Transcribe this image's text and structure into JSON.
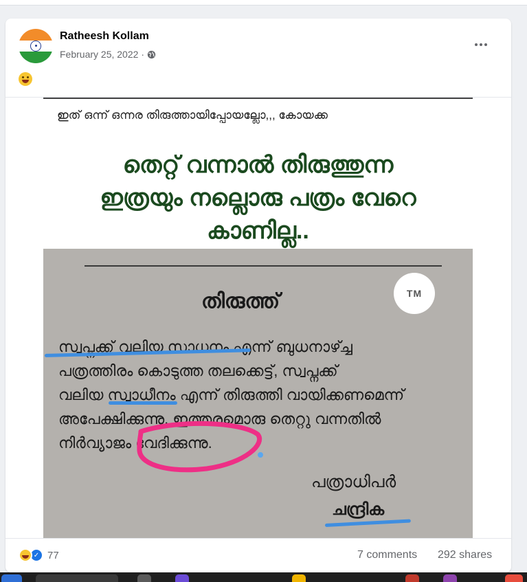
{
  "post": {
    "author": "Ratheesh Kollam",
    "date": "February 25, 2022",
    "separator": "·",
    "privacy_icon": "globe-icon",
    "more_icon": "more-horizontal-icon",
    "post_emoji": "grinning-tongue-emoji"
  },
  "image": {
    "caption_line": "ഇത് ഒന്ന് ഒന്നര തിരുത്തായിപ്പോയല്ലോ,,, കോയക്ക",
    "headline_1": "തെറ്റ് വന്നാൽ തിരുത്തുന്ന",
    "headline_2": "ഇത്രയും നല്ലൊരു പത്രം വേറെ",
    "headline_3": "കാണില്ല..",
    "watermark": "TM",
    "paper_title": "തിരുത്ത്",
    "body_1": "സ്വപ്നക്ക് വലിയ സാധനം എന്ന് ബുധനാഴ്ച്ച",
    "body_2": "പത്രത്തിരം കൊടുത്ത തലക്കെട്ട്, സ്വപ്നക്ക്",
    "body_3": "വലിയ സ്വാധീനം എന്ന് തിരുത്തി വായിക്കണമെന്ന്",
    "body_4": "അപേക്ഷിക്കുന്നു. ഇത്തരമൊരു തെറ്റു വന്നതിൽ",
    "body_5": "നിർവ്യാജം വേദിക്കുന്നു.",
    "signature_1": "പത്രാധിപർ",
    "signature_2": "ചന്ദ്രിക"
  },
  "footer": {
    "reaction_count": "77",
    "comments": "7 comments",
    "shares": "292 shares",
    "reaction_icons": [
      "haha-icon",
      "like-icon"
    ]
  },
  "colors": {
    "headline": "#1b4a1f",
    "annotation_blue": "#3f8ee0",
    "annotation_pink": "#ee2f86",
    "muted_text": "#65676b"
  }
}
